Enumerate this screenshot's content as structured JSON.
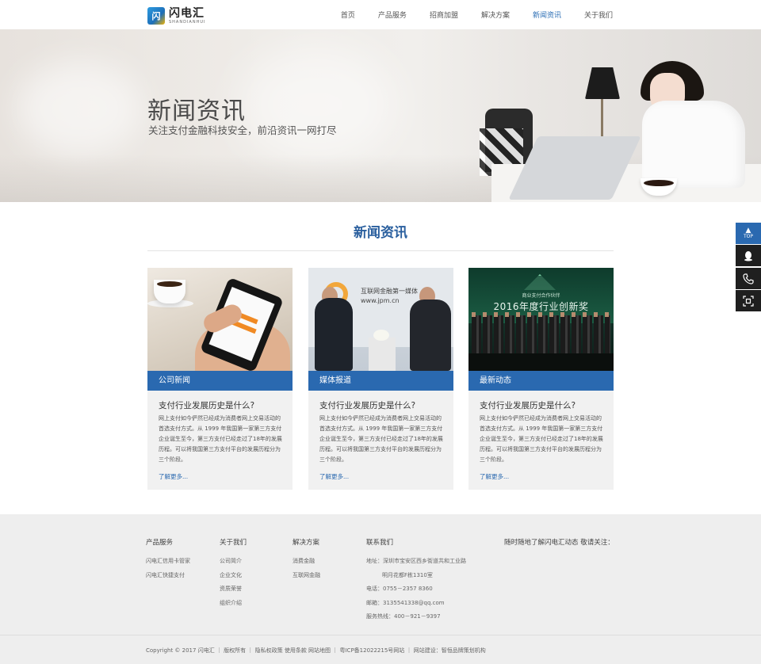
{
  "header": {
    "logo_mark": "闪",
    "logo_cn": "闪电汇",
    "logo_en": "SHANDIANHUI",
    "nav": [
      {
        "label": "首页",
        "active": false
      },
      {
        "label": "产品服务",
        "active": false
      },
      {
        "label": "招商加盟",
        "active": false
      },
      {
        "label": "解决方案",
        "active": false
      },
      {
        "label": "新闻资讯",
        "active": true
      },
      {
        "label": "关于我们",
        "active": false
      }
    ]
  },
  "banner": {
    "title": "新闻资讯",
    "subtitle": "关注支付金融科技安全，前沿资讯一网打尽"
  },
  "section": {
    "title": "新闻资讯"
  },
  "cards": [
    {
      "category": "公司新闻",
      "title": "支付行业发展历史是什么?",
      "desc": "网上支付如今俨然已经成为消费者网上交易活动的首选支付方式。从 1999 年我国第一家第三方支付企业诞生至今，第三方支付已经走过了18年的发展历程。可以将我国第三方支付平台的发展历程分为三个阶段。",
      "more": "了解更多..."
    },
    {
      "category": "媒体报道",
      "title": "支付行业发展历史是什么?",
      "desc": "网上支付如今俨然已经成为消费者网上交易活动的首选支付方式。从 1999 年我国第一家第三方支付企业诞生至今，第三方支付已经走过了18年的发展历程。可以将我国第三方支付平台的发展历程分为三个阶段。",
      "more": "了解更多...",
      "image_text": [
        "互联网金融第一媒体",
        "www.jpm.cn"
      ]
    },
    {
      "category": "最新动态",
      "title": "支付行业发展历史是什么?",
      "desc": "网上支付如今俨然已经成为消费者网上交易活动的首选支付方式。从 1999 年我国第一家第三方支付企业诞生至今，第三方支付已经走过了18年的发展历程。可以将我国第三方支付平台的发展历程分为三个阶段。",
      "more": "了解更多...",
      "image_text": [
        "商业支付合作伙伴",
        "2016年度行业创新奖"
      ]
    }
  ],
  "float_bar": {
    "top_label": "TOP",
    "icons": [
      "qq-icon",
      "phone-icon",
      "qr-code-icon"
    ]
  },
  "footer": {
    "columns": [
      {
        "heading": "产品服务",
        "items": [
          "闪电汇信用卡管家",
          "闪电汇快捷支付"
        ]
      },
      {
        "heading": "关于我们",
        "items": [
          "公司简介",
          "企业文化",
          "资质荣誉",
          "组织介绍"
        ]
      },
      {
        "heading": "解决方案",
        "items": [
          "消费金融",
          "互联网金融"
        ]
      },
      {
        "heading": "联系我们",
        "items": [
          "地址：深圳市宝安区西乡街道共和工业路",
          "明月花都F栋1310室",
          "电话：0755－2357 8360",
          "邮箱：3135541338@qq.com",
          "服务热线：400－921－9397"
        ]
      }
    ],
    "follow_text": "随时随地了解闪电汇动态 敬请关注：",
    "copyright": "Copyright © 2017 闪电汇 ｜ 版权所有 ｜ 隐私权政策 使用条款 网站地图 ｜ 粤ICP备12022215号网站 ｜ 网站建设：智恒品牌策划机构"
  },
  "colors": {
    "accent": "#2a69b0",
    "section_title": "#2a5f9e",
    "footer_bg": "#eeeeee",
    "card_bg": "#f1f1f1"
  }
}
